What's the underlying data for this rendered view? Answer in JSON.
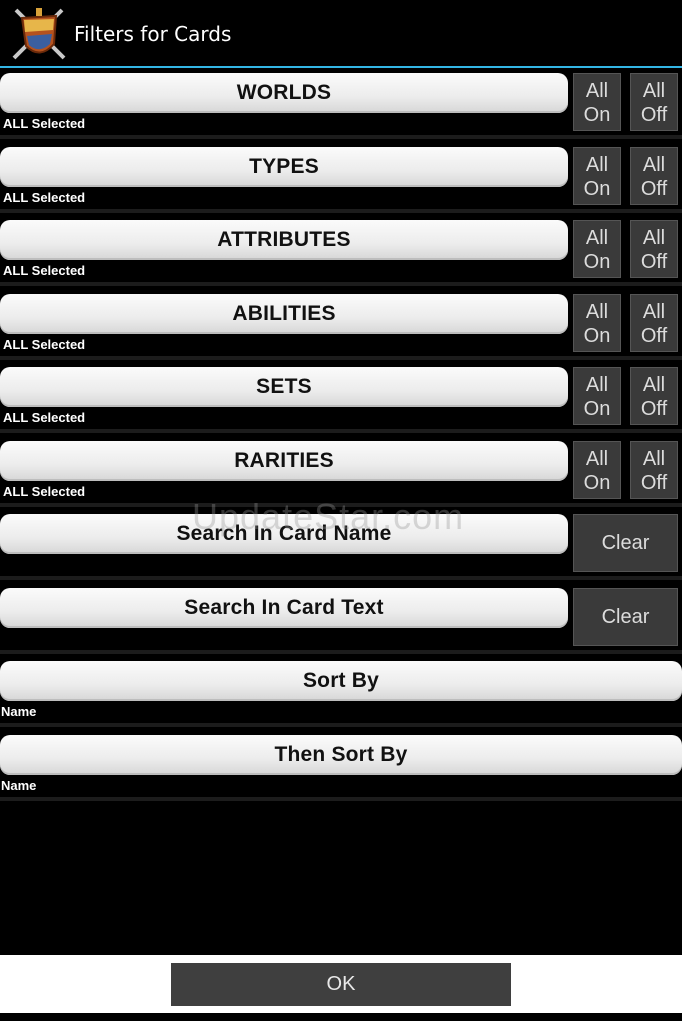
{
  "header": {
    "title": "Filters for Cards",
    "icon": "shield-swords-icon"
  },
  "filters": [
    {
      "label": "WORLDS",
      "status": "ALL Selected",
      "on_top": "All",
      "on_bottom": "On",
      "off_top": "All",
      "off_bottom": "Off"
    },
    {
      "label": "TYPES",
      "status": "ALL Selected",
      "on_top": "All",
      "on_bottom": "On",
      "off_top": "All",
      "off_bottom": "Off"
    },
    {
      "label": "ATTRIBUTES",
      "status": "ALL Selected",
      "on_top": "All",
      "on_bottom": "On",
      "off_top": "All",
      "off_bottom": "Off"
    },
    {
      "label": "ABILITIES",
      "status": "ALL Selected",
      "on_top": "All",
      "on_bottom": "On",
      "off_top": "All",
      "off_bottom": "Off"
    },
    {
      "label": "SETS",
      "status": "ALL Selected",
      "on_top": "All",
      "on_bottom": "On",
      "off_top": "All",
      "off_bottom": "Off"
    },
    {
      "label": "RARITIES",
      "status": "ALL Selected",
      "on_top": "All",
      "on_bottom": "On",
      "off_top": "All",
      "off_bottom": "Off"
    }
  ],
  "search": {
    "card_name": {
      "label": "Search In Card Name",
      "clear": "Clear"
    },
    "card_text": {
      "label": "Search In Card Text",
      "clear": "Clear"
    }
  },
  "sort": {
    "sort_by": {
      "label": "Sort By",
      "value": "Name"
    },
    "then_sort_by": {
      "label": "Then Sort By",
      "value": "Name"
    }
  },
  "watermark": "UpdateStar.com",
  "footer": {
    "ok_label": "OK"
  },
  "colors": {
    "accent": "#33b5e5",
    "background": "#000000",
    "button_dark": "#3a3a3a"
  }
}
